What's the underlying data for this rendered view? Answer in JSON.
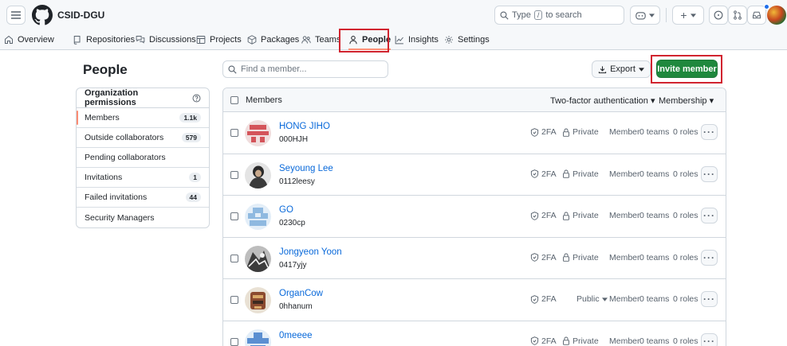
{
  "header": {
    "org_name": "CSID-DGU",
    "search_prefix": "Type",
    "search_key": "/",
    "search_suffix": "to search",
    "plus_label": "+"
  },
  "nav": {
    "items": [
      {
        "label": "Overview",
        "icon": "home-icon"
      },
      {
        "label": "Repositories",
        "icon": "repo-icon"
      },
      {
        "label": "Discussions",
        "icon": "comment-discussion-icon"
      },
      {
        "label": "Projects",
        "icon": "table-icon"
      },
      {
        "label": "Packages",
        "icon": "package-icon"
      },
      {
        "label": "Teams",
        "icon": "people-icon"
      },
      {
        "label": "People",
        "icon": "person-icon",
        "active": true
      },
      {
        "label": "Insights",
        "icon": "graph-icon"
      },
      {
        "label": "Settings",
        "icon": "gear-icon"
      }
    ]
  },
  "page": {
    "title": "People"
  },
  "sidebar": {
    "header": "Organization permissions",
    "items": [
      {
        "label": "Members",
        "count": "1.1k",
        "active": true
      },
      {
        "label": "Outside collaborators",
        "count": "579"
      },
      {
        "label": "Pending collaborators",
        "count": ""
      },
      {
        "label": "Invitations",
        "count": "1"
      },
      {
        "label": "Failed invitations",
        "count": "44"
      },
      {
        "label": "Security Managers",
        "count": ""
      }
    ]
  },
  "toolbar": {
    "find_placeholder": "Find a member...",
    "export_label": "Export",
    "invite_label": "Invite member"
  },
  "table": {
    "members_label": "Members",
    "two_factor_label": "Two-factor authentication",
    "membership_label": "Membership",
    "rows": [
      {
        "name": "HONG JIHO",
        "username": "000HJH",
        "tfa": "2FA",
        "visibility": "Private",
        "role": "Member",
        "teams": "0 teams",
        "roles": "0 roles"
      },
      {
        "name": "Seyoung Lee",
        "username": "0112leesy",
        "tfa": "2FA",
        "visibility": "Private",
        "role": "Member",
        "teams": "0 teams",
        "roles": "0 roles"
      },
      {
        "name": "GO",
        "username": "0230cp",
        "tfa": "2FA",
        "visibility": "Private",
        "role": "Member",
        "teams": "0 teams",
        "roles": "0 roles"
      },
      {
        "name": "Jongyeon Yoon",
        "username": "0417yjy",
        "tfa": "2FA",
        "visibility": "Private",
        "role": "Member",
        "teams": "0 teams",
        "roles": "0 roles"
      },
      {
        "name": "OrganCow",
        "username": "0hhanum",
        "tfa": "2FA",
        "visibility": "Public",
        "role": "Member",
        "teams": "0 teams",
        "roles": "0 roles"
      },
      {
        "name": "0meeee",
        "username": "",
        "tfa": "2FA",
        "visibility": "Private",
        "role": "Member",
        "teams": "0 teams",
        "roles": "0 roles"
      }
    ]
  },
  "colors": {
    "accent_green": "#1f883d",
    "link_blue": "#0969da",
    "highlight_red": "#d1242f",
    "active_underline": "#fd8c73"
  }
}
